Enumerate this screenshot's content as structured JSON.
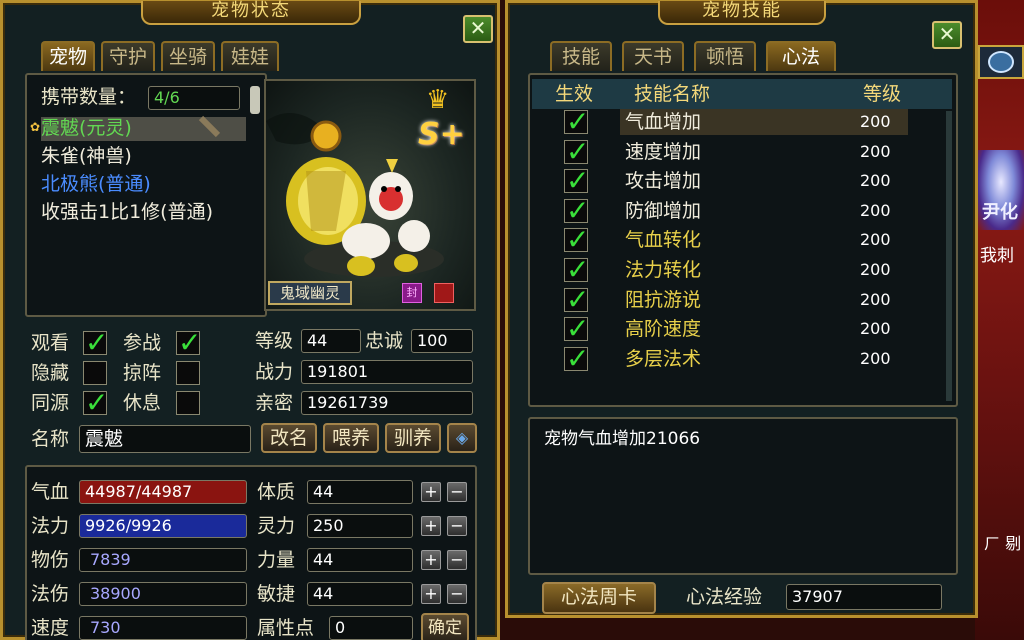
{
  "pet_status": {
    "title": "宠物状态",
    "close": "✕",
    "tabs": [
      "宠物",
      "守护",
      "坐骑",
      "娃娃"
    ],
    "carry_label": "携带数量：",
    "carry_value": "4/6",
    "pets": [
      {
        "name": "震魃(元灵)",
        "color": "#62d852"
      },
      {
        "name": "朱雀(神兽)",
        "color": "#f0ecdc"
      },
      {
        "name": "北极熊(普通)",
        "color": "#4a8cff"
      },
      {
        "name": "收强击1比1修(普通)",
        "color": "#f0ecdc"
      }
    ],
    "grade_badge": "S+",
    "pet_caption": "鬼域幽灵",
    "options": [
      {
        "label": "观看",
        "checked": true
      },
      {
        "label": "参战",
        "checked": true
      },
      {
        "label": "隐藏",
        "checked": false
      },
      {
        "label": "掠阵",
        "checked": false
      },
      {
        "label": "同源",
        "checked": true
      },
      {
        "label": "休息",
        "checked": false
      }
    ],
    "level_label": "等级",
    "level": "44",
    "loyalty_label": "忠诚",
    "loyalty": "100",
    "power_label": "战力",
    "power": "191801",
    "intimacy_label": "亲密",
    "intimacy": "19261739",
    "name_label": "名称",
    "name_value": "震魃",
    "rename_btn": "改名",
    "feed_btn": "喂养",
    "train_btn": "驯养",
    "stats_left": [
      {
        "label": "气血",
        "value": "44987/44987",
        "kind": "hp"
      },
      {
        "label": "法力",
        "value": "9926/9926",
        "kind": "mp"
      },
      {
        "label": "物伤",
        "value": "7839",
        "kind": "plain"
      },
      {
        "label": "法伤",
        "value": "38900",
        "kind": "plain"
      },
      {
        "label": "速度",
        "value": "730",
        "kind": "plain"
      }
    ],
    "stats_right": [
      {
        "label": "体质",
        "value": "44"
      },
      {
        "label": "灵力",
        "value": "250"
      },
      {
        "label": "力量",
        "value": "44"
      },
      {
        "label": "敏捷",
        "value": "44"
      },
      {
        "label": "属性点",
        "value": "0"
      }
    ],
    "confirm_btn": "确定"
  },
  "pet_skills": {
    "title": "宠物技能",
    "close": "✕",
    "tabs": [
      "技能",
      "天书",
      "顿悟",
      "心法"
    ],
    "headers": {
      "effect": "生效",
      "name": "技能名称",
      "level": "等级"
    },
    "skills": [
      {
        "name": "气血增加",
        "level": "200",
        "color": "#f0ecdc"
      },
      {
        "name": "速度增加",
        "level": "200",
        "color": "#f0ecdc"
      },
      {
        "name": "攻击增加",
        "level": "200",
        "color": "#f0ecdc"
      },
      {
        "name": "防御增加",
        "level": "200",
        "color": "#f0ecdc"
      },
      {
        "name": "气血转化",
        "level": "200",
        "color": "#e8d04a"
      },
      {
        "name": "法力转化",
        "level": "200",
        "color": "#e8d04a"
      },
      {
        "name": "阻抗游说",
        "level": "200",
        "color": "#e8d04a"
      },
      {
        "name": "高阶速度",
        "level": "200",
        "color": "#e8d04a"
      },
      {
        "name": "多层法术",
        "level": "200",
        "color": "#e8d04a"
      }
    ],
    "description": "宠物气血增加21066",
    "weekly_card_btn": "心法周卡",
    "exp_label": "心法经验",
    "exp_value": "37907"
  },
  "background": {
    "text1": "尹化",
    "text2": "我刺",
    "text3": "ㄏ 剔"
  }
}
